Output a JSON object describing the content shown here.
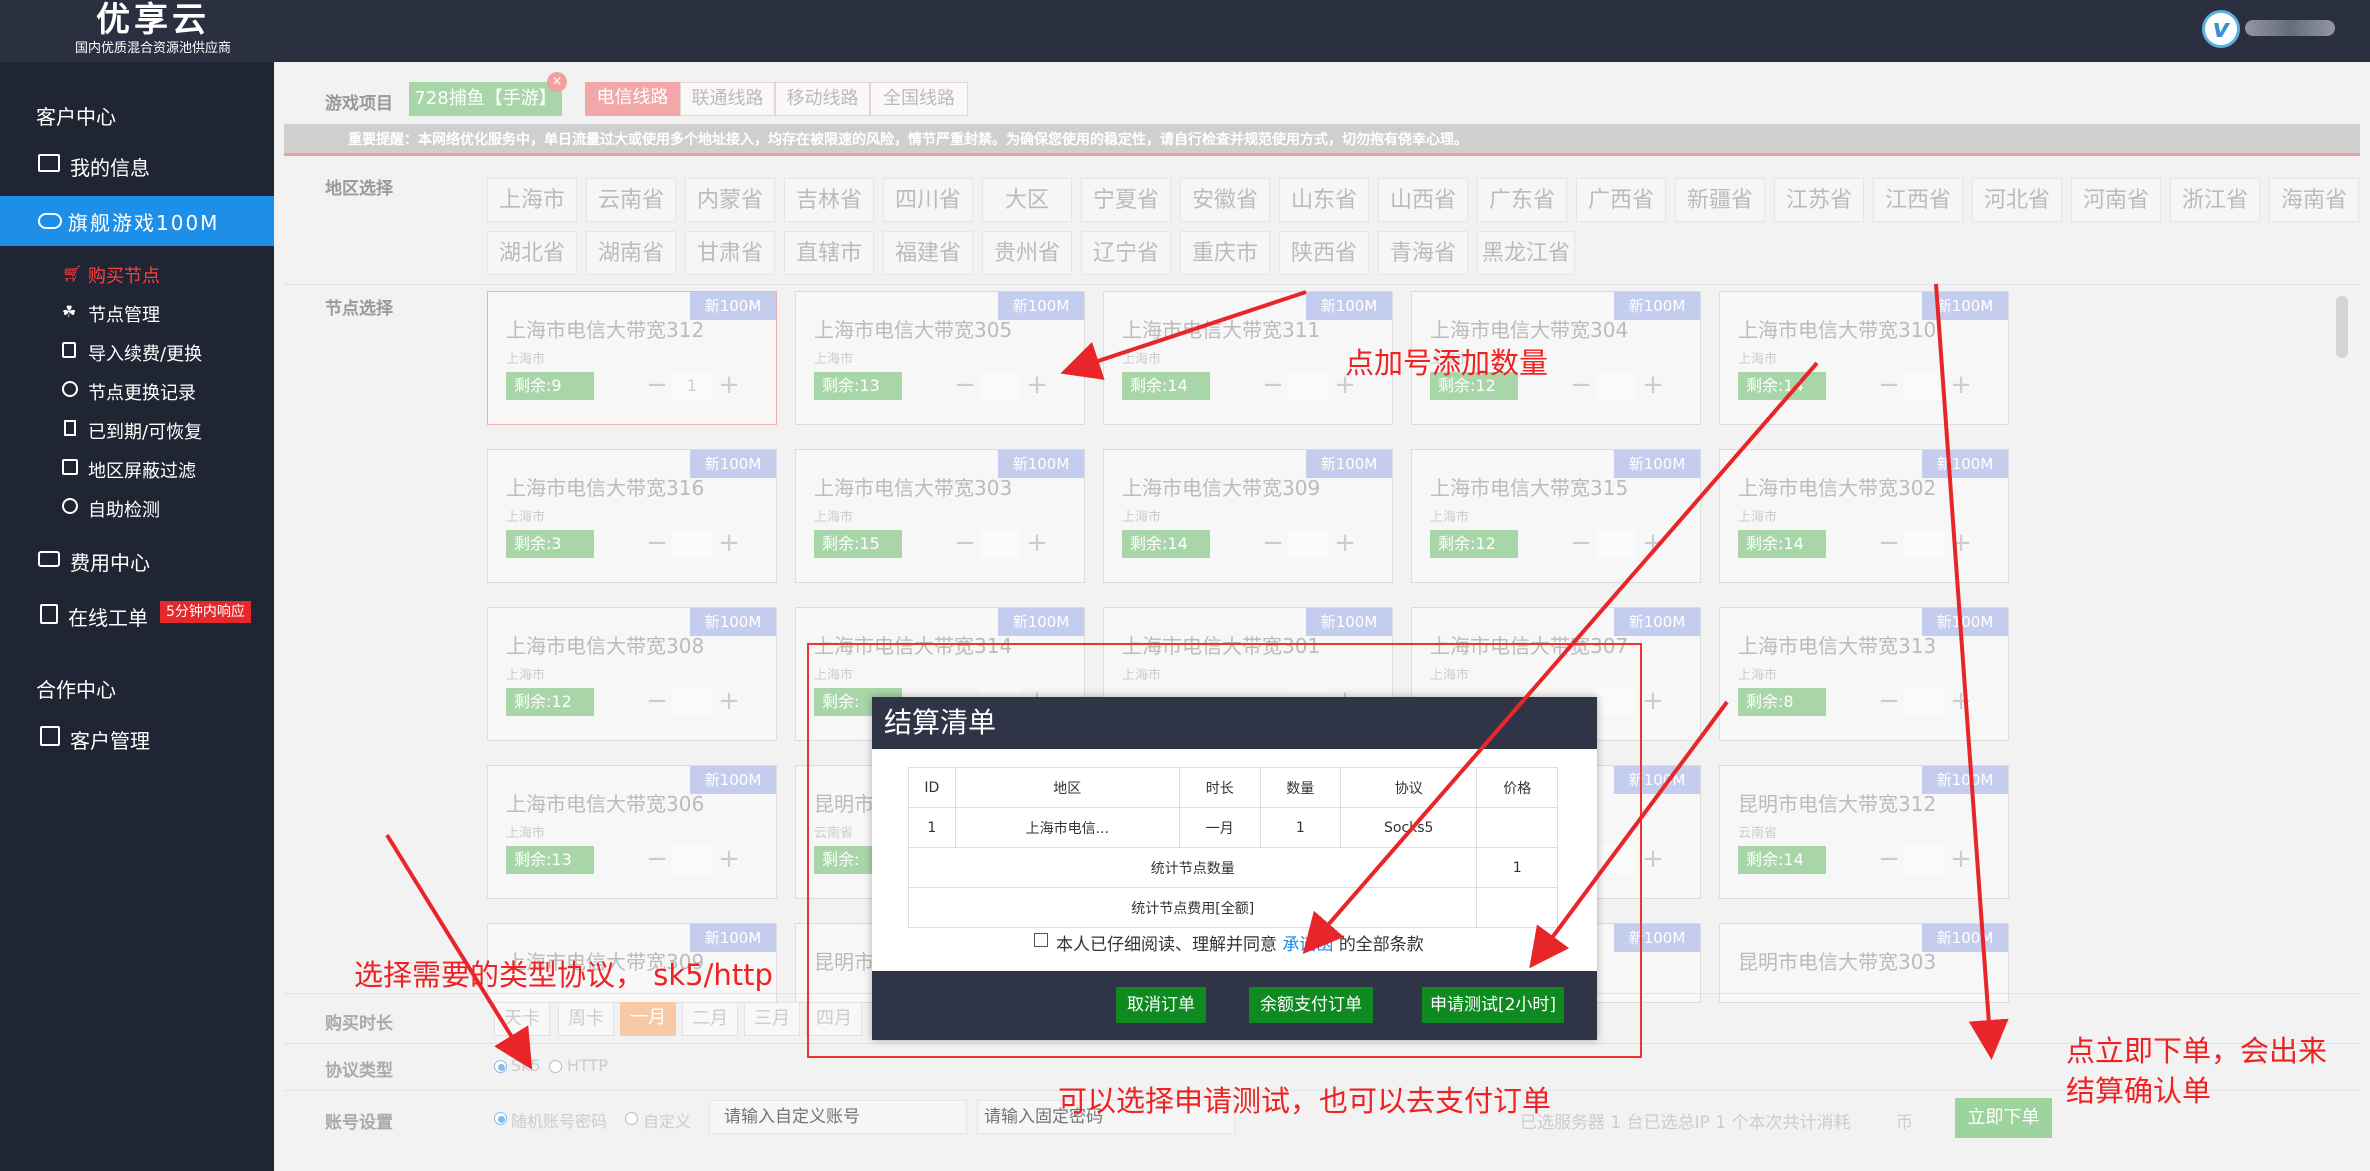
{
  "header": {
    "logo_title": "优享云",
    "logo_subtitle": "国内优质混合资源池供应商",
    "vip_mark": "v"
  },
  "sidebar": {
    "customer_center": "客户中心",
    "my_info": "我的信息",
    "flagship": "旗舰游戏100M",
    "subitems": [
      "购买节点",
      "节点管理",
      "导入续费/更换",
      "节点更换记录",
      "已到期/可恢复",
      "地区屏蔽过滤",
      "自助检测"
    ],
    "cost_center": "费用中心",
    "ticket": "在线工单",
    "ticket_badge": "5分钟内响应",
    "partner_center": "合作中心",
    "customer_mgmt": "客户管理"
  },
  "filters": {
    "game_label": "游戏项目",
    "game_chip": "728捕鱼【手游】",
    "lines": [
      "电信线路",
      "联通线路",
      "移动线路",
      "全国线路"
    ],
    "notice": "重要提醒：本网络优化服务中，单日流量过大或使用多个地址接入，均存在被限速的风险，情节严重封禁。为确保您使用的稳定性，请自行检查并规范使用方式，切勿抱有侥幸心理。",
    "region_label": "地区选择",
    "regions_row1": [
      "上海市",
      "云南省",
      "内蒙省",
      "吉林省",
      "四川省",
      "大区",
      "宁夏省",
      "安徽省",
      "山东省",
      "山西省",
      "广东省",
      "广西省",
      "新疆省",
      "江苏省",
      "江西省",
      "河北省",
      "河南省",
      "浙江省",
      "海南省"
    ],
    "regions_row2": [
      "湖北省",
      "湖南省",
      "甘肃省",
      "直辖市",
      "福建省",
      "贵州省",
      "辽宁省",
      "重庆市",
      "陕西省",
      "青海省",
      "黑龙江省"
    ],
    "node_label": "节点选择"
  },
  "nodes": {
    "tag": "新100M",
    "rows": [
      [
        {
          "name": "上海市电信大带宽312",
          "city": "上海市",
          "remain": "剩余:9",
          "qty": "1"
        },
        {
          "name": "上海市电信大带宽305",
          "city": "上海市",
          "remain": "剩余:13",
          "qty": ""
        },
        {
          "name": "上海市电信大带宽311",
          "city": "上海市",
          "remain": "剩余:14",
          "qty": ""
        },
        {
          "name": "上海市电信大带宽304",
          "city": "上海市",
          "remain": "剩余:12",
          "qty": ""
        },
        {
          "name": "上海市电信大带宽310",
          "city": "上海市",
          "remain": "剩余:14",
          "qty": ""
        }
      ],
      [
        {
          "name": "上海市电信大带宽316",
          "city": "上海市",
          "remain": "剩余:3",
          "qty": ""
        },
        {
          "name": "上海市电信大带宽303",
          "city": "上海市",
          "remain": "剩余:15",
          "qty": ""
        },
        {
          "name": "上海市电信大带宽309",
          "city": "上海市",
          "remain": "剩余:14",
          "qty": ""
        },
        {
          "name": "上海市电信大带宽315",
          "city": "上海市",
          "remain": "剩余:12",
          "qty": ""
        },
        {
          "name": "上海市电信大带宽302",
          "city": "上海市",
          "remain": "剩余:14",
          "qty": ""
        }
      ],
      [
        {
          "name": "上海市电信大带宽308",
          "city": "上海市",
          "remain": "剩余:12",
          "qty": ""
        },
        {
          "name": "上海市电信大带宽314",
          "city": "上海市",
          "remain": "剩余:",
          "qty": ""
        },
        {
          "name": "上海市电信大带宽301",
          "city": "上海市",
          "remain": "",
          "qty": ""
        },
        {
          "name": "上海市电信大带宽307",
          "city": "上海市",
          "remain": "",
          "qty": ""
        },
        {
          "name": "上海市电信大带宽313",
          "city": "上海市",
          "remain": "剩余:8",
          "qty": ""
        }
      ],
      [
        {
          "name": "上海市电信大带宽306",
          "city": "上海市",
          "remain": "剩余:13",
          "qty": ""
        },
        {
          "name": "昆明市",
          "city": "云南省",
          "remain": "剩余:",
          "qty": ""
        },
        {
          "name": "",
          "city": "",
          "remain": "",
          "qty": ""
        },
        {
          "name": "306",
          "city": "",
          "remain": "",
          "qty": ""
        },
        {
          "name": "昆明市电信大带宽312",
          "city": "云南省",
          "remain": "剩余:14",
          "qty": ""
        }
      ],
      [
        {
          "name": "上海市电信大带宽309",
          "city": "",
          "remain": "",
          "qty": ""
        },
        {
          "name": "昆明市",
          "city": "",
          "remain": "",
          "qty": ""
        },
        {
          "name": "",
          "city": "",
          "remain": "",
          "qty": ""
        },
        {
          "name": "310",
          "city": "",
          "remain": "",
          "qty": ""
        },
        {
          "name": "昆明市电信大带宽303",
          "city": "",
          "remain": "",
          "qty": ""
        }
      ]
    ]
  },
  "bottom": {
    "duration_label": "购买时长",
    "durations": [
      "天卡",
      "周卡",
      "一月",
      "二月",
      "三月",
      "四月"
    ],
    "protocol_label": "协议类型",
    "protocols": [
      "Sk5",
      "HTTP"
    ],
    "account_label": "账号设置",
    "account_opts": [
      "随机账号密码",
      "自定义"
    ],
    "account_placeholder": "请输入自定义账号",
    "password_placeholder": "请输入固定密码",
    "summary": "已选服务器 1 台已选总IP 1 个本次共计消耗",
    "currency": "币",
    "submit": "立即下单"
  },
  "modal": {
    "title": "结算清单",
    "headers": [
      "ID",
      "地区",
      "时长",
      "数量",
      "协议",
      "价格"
    ],
    "row": [
      "1",
      "上海市电信...",
      "一月",
      "1",
      "Socks5",
      ""
    ],
    "count_label": "统计节点数量",
    "count_value": "1",
    "fee_label": "统计节点费用[全额]",
    "agree_prefix": "本人已仔细阅读、理解并同意",
    "agree_link": "承诺函",
    "agree_suffix": "的全部条款",
    "btn_cancel": "取消订单",
    "btn_pay": "余额支付订单",
    "btn_test": "申请测试[2小时]"
  },
  "annotations": {
    "plus": "点加号添加数量",
    "protocol": "选择需要的类型协议， sk5/http",
    "test": "可以选择申请测试，也可以去支付订单",
    "order": "点立即下单，会出来\n结算确认单"
  }
}
